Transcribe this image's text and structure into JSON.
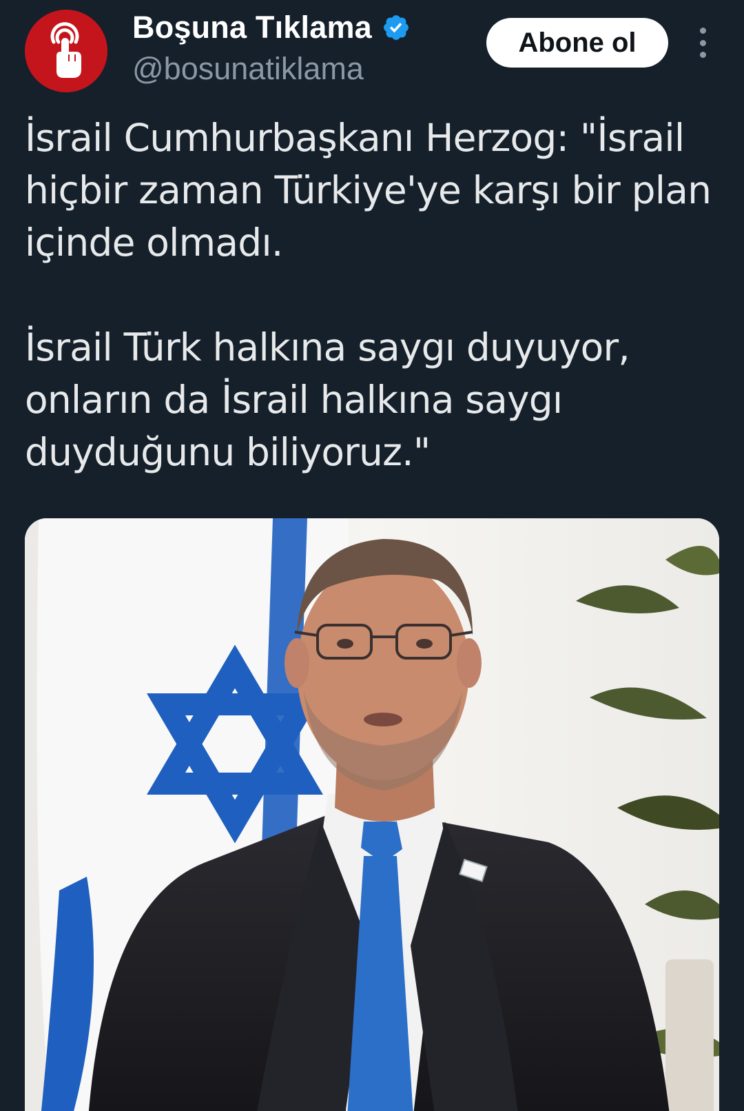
{
  "account": {
    "display_name": "Boşuna Tıklama",
    "handle": "@bosunatiklama",
    "verified": true,
    "avatar_icon": "pointing-hand-icon",
    "avatar_color": "#c4151c",
    "verified_color": "#1d9bf0"
  },
  "actions": {
    "subscribe_label": "Abone ol",
    "more_icon": "more-vertical-icon"
  },
  "tweet": {
    "paragraphs": [
      "İsrail Cumhurbaşkanı Herzog: \"İsrail hiçbir zaman Türkiye'ye karşı bir plan içinde olmadı.",
      "İsrail Türk halkına saygı duyuyor, onların da İsrail halkına saygı duyduğunu biliyoruz.\""
    ]
  },
  "media": {
    "type": "photo",
    "colors": {
      "background": "#f4f3f0",
      "flag_blue": "#1f5fbf",
      "suit": "#1e1e22",
      "tie": "#2b6fc9",
      "skin": "#c98b6e"
    }
  },
  "theme": {
    "background": "#15202b",
    "text": "#e7e9ea",
    "secondary_text": "#8b98a5"
  }
}
